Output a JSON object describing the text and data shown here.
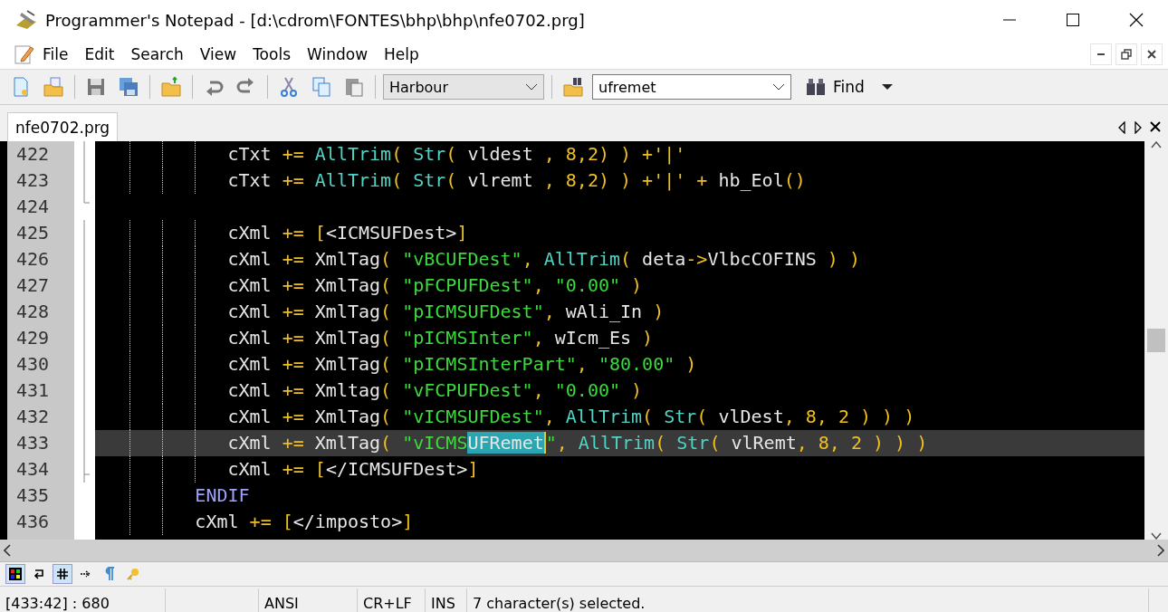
{
  "window": {
    "title": "Programmer's Notepad - [d:\\cdrom\\FONTES\\bhp\\bhp\\nfe0702.prg]"
  },
  "menu": [
    "File",
    "Edit",
    "Search",
    "View",
    "Tools",
    "Window",
    "Help"
  ],
  "toolbar": {
    "language": "Harbour",
    "search_value": "ufremet",
    "find_label": "Find"
  },
  "tabs": [
    {
      "label": "nfe0702.prg",
      "selected": true
    }
  ],
  "editor": {
    "lines": [
      {
        "number": "422",
        "kind": "fold_mid",
        "current": false,
        "tokens": [
          {
            "kind": "id",
            "s": "            cTxt"
          },
          {
            "kind": "op",
            "s": " += "
          },
          {
            "kind": "fn",
            "s": "AllTrim"
          },
          {
            "kind": "op",
            "s": "( "
          },
          {
            "kind": "fn",
            "s": "Str"
          },
          {
            "kind": "op",
            "s": "( "
          },
          {
            "kind": "id",
            "s": "vldest "
          },
          {
            "kind": "op",
            "s": ", "
          },
          {
            "kind": "num",
            "s": "8,2"
          },
          {
            "kind": "op",
            "s": ") ) +"
          },
          {
            "kind": "num",
            "s": "'|'"
          }
        ]
      },
      {
        "number": "423",
        "kind": "fold_mid",
        "current": false,
        "tokens": [
          {
            "kind": "id",
            "s": "            cTxt"
          },
          {
            "kind": "op",
            "s": " += "
          },
          {
            "kind": "fn",
            "s": "AllTrim"
          },
          {
            "kind": "op",
            "s": "( "
          },
          {
            "kind": "fn",
            "s": "Str"
          },
          {
            "kind": "op",
            "s": "( "
          },
          {
            "kind": "id",
            "s": "vlremt "
          },
          {
            "kind": "op",
            "s": ", "
          },
          {
            "kind": "num",
            "s": "8,2"
          },
          {
            "kind": "op",
            "s": ") ) +"
          },
          {
            "kind": "num",
            "s": "'|'"
          },
          {
            "kind": "op",
            "s": " + "
          },
          {
            "kind": "id",
            "s": "hb_Eol"
          },
          {
            "kind": "op",
            "s": "()"
          }
        ]
      },
      {
        "number": "424",
        "kind": "fold_end",
        "current": false
      },
      {
        "number": "425",
        "kind": "fold_mid",
        "current": false,
        "tokens": [
          {
            "kind": "id",
            "s": "            cXml"
          },
          {
            "kind": "op",
            "s": " += ["
          },
          {
            "kind": "id",
            "s": "<ICMSUFDest>"
          },
          {
            "kind": "op",
            "s": "]"
          }
        ]
      },
      {
        "number": "426",
        "kind": "fold_mid",
        "current": false,
        "tokens": [
          {
            "kind": "id",
            "s": "            cXml"
          },
          {
            "kind": "op",
            "s": " += "
          },
          {
            "kind": "id",
            "s": "XmlTag"
          },
          {
            "kind": "op",
            "s": "( "
          },
          {
            "kind": "str",
            "s": "\"vBCUFDest\""
          },
          {
            "kind": "op",
            "s": ", "
          },
          {
            "kind": "fn",
            "s": "AllTrim"
          },
          {
            "kind": "op",
            "s": "( "
          },
          {
            "kind": "id",
            "s": "deta"
          },
          {
            "kind": "op",
            "s": "->"
          },
          {
            "kind": "id",
            "s": "VlbcCOFINS "
          },
          {
            "kind": "op",
            "s": ") )"
          }
        ]
      },
      {
        "number": "427",
        "kind": "fold_mid",
        "current": false,
        "tokens": [
          {
            "kind": "id",
            "s": "            cXml"
          },
          {
            "kind": "op",
            "s": " += "
          },
          {
            "kind": "id",
            "s": "XmlTag"
          },
          {
            "kind": "op",
            "s": "( "
          },
          {
            "kind": "str",
            "s": "\"pFCPUFDest\""
          },
          {
            "kind": "op",
            "s": ", "
          },
          {
            "kind": "str",
            "s": "\"0.00\""
          },
          {
            "kind": "op",
            "s": " )"
          }
        ]
      },
      {
        "number": "428",
        "kind": "fold_mid",
        "current": false,
        "tokens": [
          {
            "kind": "id",
            "s": "            cXml"
          },
          {
            "kind": "op",
            "s": " += "
          },
          {
            "kind": "id",
            "s": "XmlTag"
          },
          {
            "kind": "op",
            "s": "( "
          },
          {
            "kind": "str",
            "s": "\"pICMSUFDest\""
          },
          {
            "kind": "op",
            "s": ", "
          },
          {
            "kind": "id",
            "s": "wAli_In "
          },
          {
            "kind": "op",
            "s": ")"
          }
        ]
      },
      {
        "number": "429",
        "kind": "fold_mid",
        "current": false,
        "tokens": [
          {
            "kind": "id",
            "s": "            cXml"
          },
          {
            "kind": "op",
            "s": " += "
          },
          {
            "kind": "id",
            "s": "XmlTag"
          },
          {
            "kind": "op",
            "s": "( "
          },
          {
            "kind": "str",
            "s": "\"pICMSInter\""
          },
          {
            "kind": "op",
            "s": ", "
          },
          {
            "kind": "id",
            "s": "wIcm_Es "
          },
          {
            "kind": "op",
            "s": ")"
          }
        ]
      },
      {
        "number": "430",
        "kind": "fold_mid",
        "current": false,
        "tokens": [
          {
            "kind": "id",
            "s": "            cXml"
          },
          {
            "kind": "op",
            "s": " += "
          },
          {
            "kind": "id",
            "s": "XmlTag"
          },
          {
            "kind": "op",
            "s": "( "
          },
          {
            "kind": "str",
            "s": "\"pICMSInterPart\""
          },
          {
            "kind": "op",
            "s": ", "
          },
          {
            "kind": "str",
            "s": "\"80.00\""
          },
          {
            "kind": "op",
            "s": " )"
          }
        ]
      },
      {
        "number": "431",
        "kind": "fold_mid",
        "current": false,
        "tokens": [
          {
            "kind": "id",
            "s": "            cXml"
          },
          {
            "kind": "op",
            "s": " += "
          },
          {
            "kind": "id",
            "s": "Xmltag"
          },
          {
            "kind": "op",
            "s": "( "
          },
          {
            "kind": "str",
            "s": "\"vFCPUFDest\""
          },
          {
            "kind": "op",
            "s": ", "
          },
          {
            "kind": "str",
            "s": "\"0.00\""
          },
          {
            "kind": "op",
            "s": " )"
          }
        ]
      },
      {
        "number": "432",
        "kind": "fold_mid",
        "current": false,
        "tokens": [
          {
            "kind": "id",
            "s": "            cXml"
          },
          {
            "kind": "op",
            "s": " += "
          },
          {
            "kind": "id",
            "s": "XmlTag"
          },
          {
            "kind": "op",
            "s": "( "
          },
          {
            "kind": "str",
            "s": "\"vICMSUFDest\""
          },
          {
            "kind": "op",
            "s": ", "
          },
          {
            "kind": "fn",
            "s": "AllTrim"
          },
          {
            "kind": "op",
            "s": "( "
          },
          {
            "kind": "fn",
            "s": "Str"
          },
          {
            "kind": "op",
            "s": "( "
          },
          {
            "kind": "id",
            "s": "vlDest"
          },
          {
            "kind": "op",
            "s": ", "
          },
          {
            "kind": "num",
            "s": "8"
          },
          {
            "kind": "op",
            "s": ", "
          },
          {
            "kind": "num",
            "s": "2"
          },
          {
            "kind": "op",
            "s": " ) ) )"
          }
        ]
      },
      {
        "number": "433",
        "kind": "fold_mid",
        "current": true,
        "tokens": [
          {
            "kind": "id",
            "s": "            cXml"
          },
          {
            "kind": "op",
            "s": " += "
          },
          {
            "kind": "id",
            "s": "XmlTag"
          },
          {
            "kind": "op",
            "s": "( "
          },
          {
            "kind": "str",
            "s": "\"vICMS"
          },
          {
            "kind": "str",
            "s": "UFRemet",
            "selected": true
          },
          {
            "kind": "str",
            "s": "\""
          },
          {
            "kind": "op",
            "s": ", "
          },
          {
            "kind": "fn",
            "s": "AllTrim"
          },
          {
            "kind": "op",
            "s": "( "
          },
          {
            "kind": "fn",
            "s": "Str"
          },
          {
            "kind": "op",
            "s": "( "
          },
          {
            "kind": "id",
            "s": "vlRemt"
          },
          {
            "kind": "op",
            "s": ", "
          },
          {
            "kind": "num",
            "s": "8"
          },
          {
            "kind": "op",
            "s": ", "
          },
          {
            "kind": "num",
            "s": "2"
          },
          {
            "kind": "op",
            "s": " ) ) )"
          }
        ]
      },
      {
        "number": "434",
        "kind": "fold_tee",
        "current": false,
        "tokens": [
          {
            "kind": "id",
            "s": "            cXml"
          },
          {
            "kind": "op",
            "s": " += ["
          },
          {
            "kind": "id",
            "s": "</ICMSUFDest>"
          },
          {
            "kind": "op",
            "s": "]"
          }
        ]
      },
      {
        "number": "435",
        "kind": "plain",
        "current": false,
        "tokens": [
          {
            "kind": "kw",
            "s": "         ENDIF"
          }
        ]
      },
      {
        "number": "436",
        "kind": "plain",
        "current": false,
        "tokens": [
          {
            "kind": "id",
            "s": "         cXml"
          },
          {
            "kind": "op",
            "s": " += ["
          },
          {
            "kind": "id",
            "s": "</imposto>"
          },
          {
            "kind": "op",
            "s": "]"
          }
        ]
      }
    ]
  },
  "view_toolbar": [
    {
      "kind": "colors",
      "pressed": true
    },
    {
      "kind": "wrap",
      "pressed": false
    },
    {
      "kind": "numbers",
      "pressed": true
    },
    {
      "kind": "tabs",
      "pressed": false
    },
    {
      "kind": "pilcrow",
      "pressed": false
    },
    {
      "kind": "key",
      "pressed": false
    }
  ],
  "status_bar": [
    "[433:42] : 680",
    "ANSI",
    "CR+LF",
    "INS",
    "7 character(s) selected."
  ]
}
